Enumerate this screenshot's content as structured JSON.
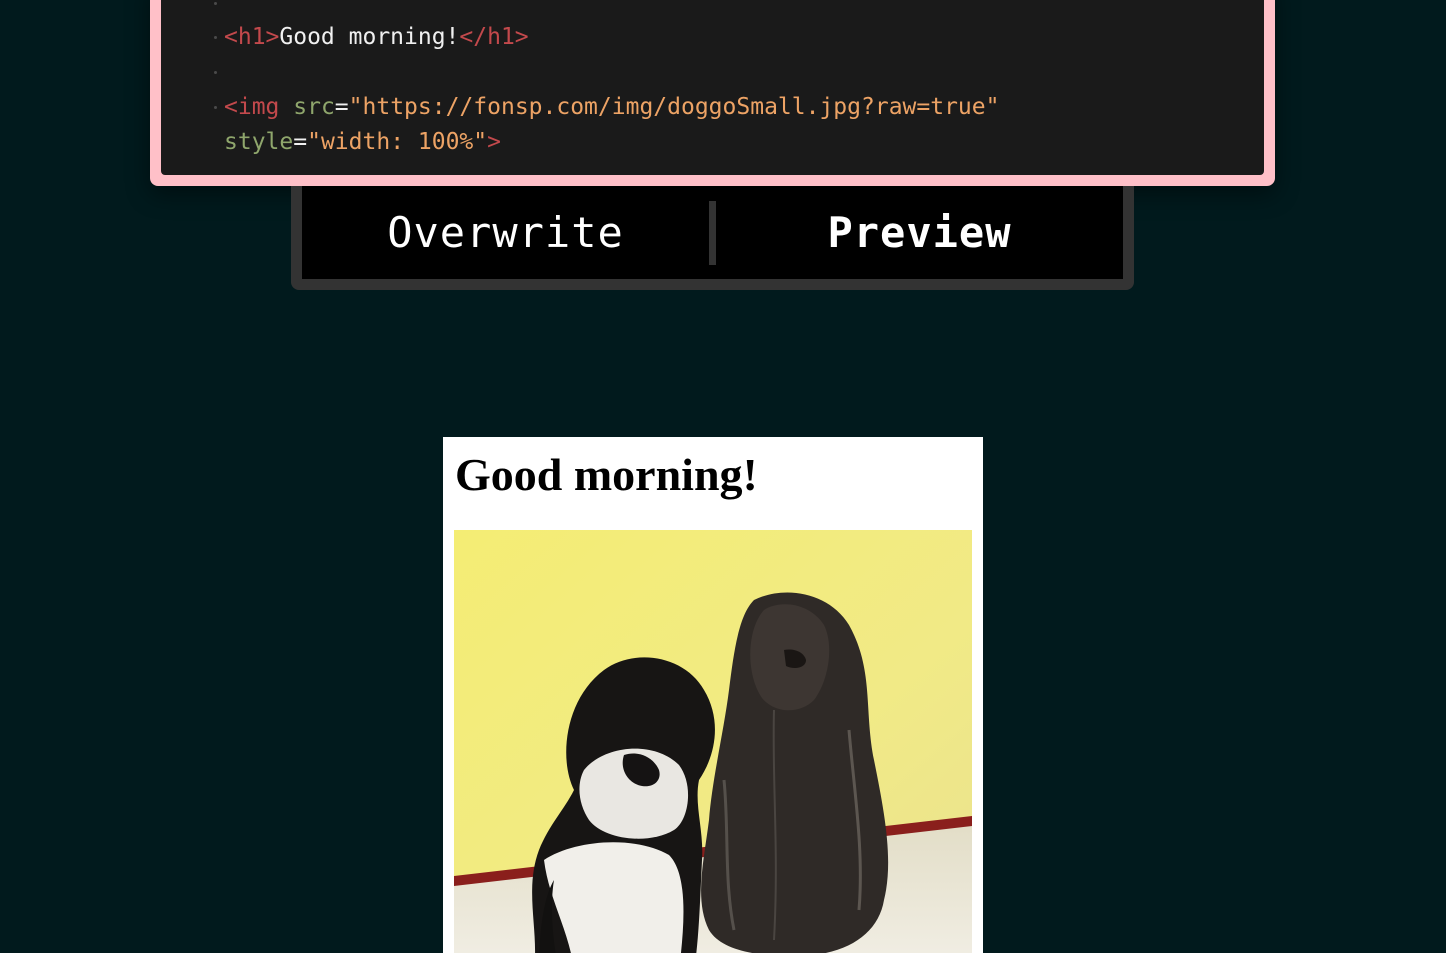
{
  "editor": {
    "lines": [
      {
        "open": "<h1>",
        "text": "Good morning!",
        "close": "</h1>"
      },
      {
        "tag_open": "<img",
        "attr1": "src",
        "eq": "=",
        "val1": "\"https://fonsp.com/img/doggoSmall.jpg?raw=true\"",
        "attr2": "style",
        "val2": "\"width: 100%\"",
        "tag_close": ">"
      }
    ],
    "frame_color": "#ffc0c8",
    "background_color": "#1a1a1a"
  },
  "toggle": {
    "overwrite_label": "Overwrite",
    "preview_label": "Preview",
    "active": "preview"
  },
  "preview": {
    "heading": "Good morning!",
    "image_icon": "photo-of-two-dogs"
  },
  "colors": {
    "page_background": "#011a1d",
    "tag": "#c3494c",
    "attribute": "#8fa66c",
    "string": "#eda365"
  }
}
